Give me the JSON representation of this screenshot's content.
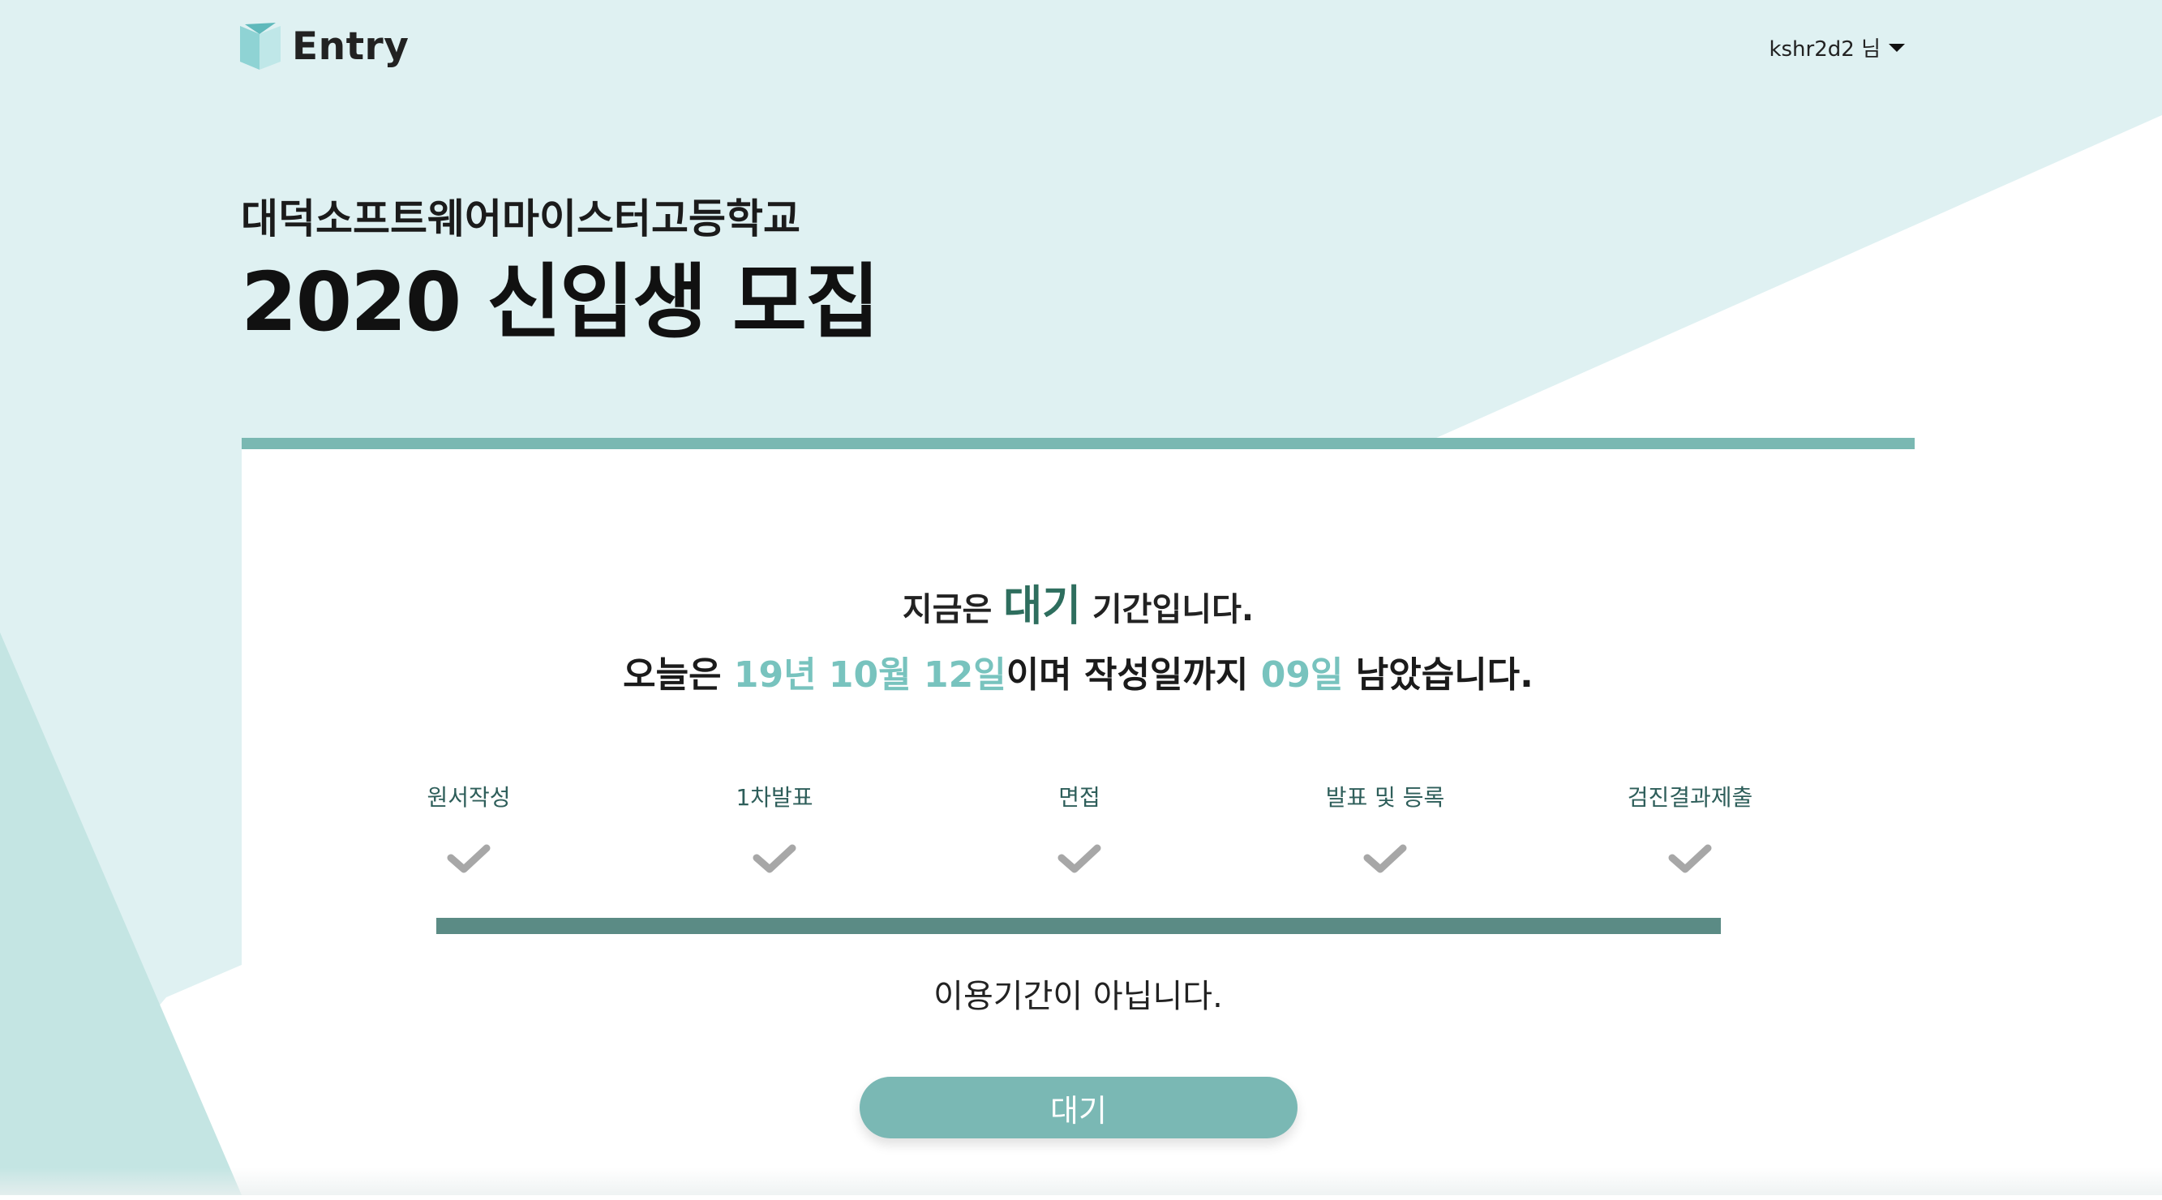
{
  "colors": {
    "bg_mint": "#dff1f2",
    "bg_mint_dark": "#c4e5e3",
    "accent_bar": "#7ab8b2",
    "progress_bar": "#5b8b85",
    "highlight": "#78c3be",
    "highlight_dark": "#2e6e5e",
    "check_gray": "#a7a7a7",
    "button": "#7ab8b4"
  },
  "header": {
    "logo_text": "Entry",
    "user_label": "kshr2d2 님"
  },
  "hero": {
    "school_name": "대덕소프트웨어마이스터고등학교",
    "title": "2020 신입생 모집"
  },
  "status": {
    "line1_prefix": "지금은",
    "line1_phase": "대기",
    "line1_suffix": "기간입니다.",
    "line2_prefix": "오늘은",
    "line2_date": "19년 10월 12일",
    "line2_middle": "이며 작성일까지",
    "line2_days": "09일",
    "line2_suffix": "남았습니다."
  },
  "steps": [
    {
      "label": "원서작성",
      "icon": "check-icon"
    },
    {
      "label": "1차발표",
      "icon": "check-icon"
    },
    {
      "label": "면접",
      "icon": "check-icon"
    },
    {
      "label": "발표 및 등록",
      "icon": "check-icon"
    },
    {
      "label": "검진결과제출",
      "icon": "check-icon"
    }
  ],
  "notice": "이용기간이 아닙니다.",
  "action_button": "대기"
}
